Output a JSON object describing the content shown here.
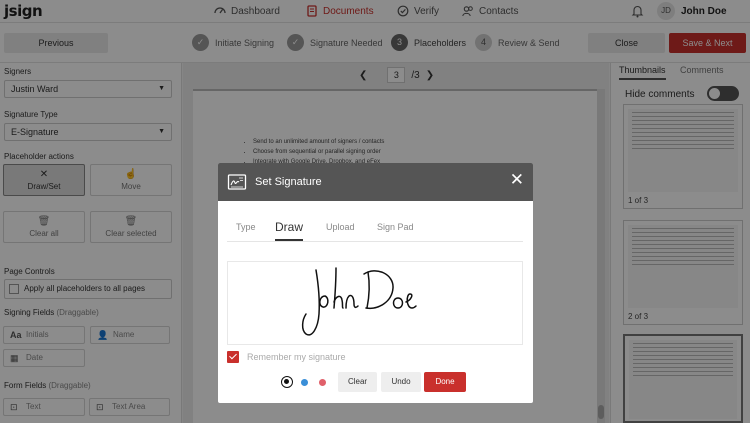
{
  "app": {
    "logo": "jsign"
  },
  "nav": {
    "items": [
      {
        "label": "Dashboard",
        "icon": "dashboard-icon"
      },
      {
        "label": "Documents",
        "icon": "document-icon",
        "active": true
      },
      {
        "label": "Verify",
        "icon": "verify-icon"
      },
      {
        "label": "Contacts",
        "icon": "contacts-icon"
      }
    ],
    "user": {
      "initials": "JD",
      "name": "John Doe"
    }
  },
  "steps": {
    "previous_label": "Previous",
    "items": [
      {
        "number": "✓",
        "label": "Initiate Signing",
        "state": "done"
      },
      {
        "number": "✓",
        "label": "Signature Needed",
        "state": "done"
      },
      {
        "number": "3",
        "label": "Placeholders",
        "state": "current"
      },
      {
        "number": "4",
        "label": "Review & Send",
        "state": "future"
      }
    ],
    "close_label": "Close",
    "save_label": "Save & Next"
  },
  "sidebar": {
    "signers_label": "Signers",
    "signer_value": "Justin Ward",
    "signature_type_label": "Signature Type",
    "signature_type_value": "E-Signature",
    "placeholder_actions_label": "Placeholder actions",
    "actions": {
      "draw": "Draw/Set",
      "move": "Move",
      "clear_all": "Clear all",
      "clear_selected": "Clear selected"
    },
    "page_controls_label": "Page Controls",
    "apply_all_label": "Apply all placeholders to all pages",
    "signing_fields_label": "Signing Fields",
    "signing_fields_hint": "(Draggable)",
    "signing_fields": {
      "initials": "Initials",
      "name": "Name",
      "date": "Date"
    },
    "form_fields_label": "Form Fields",
    "form_fields_hint": "(Draggable)",
    "form_fields": {
      "text": "Text",
      "text_area": "Text Area"
    }
  },
  "viewer": {
    "page_current": "3",
    "page_total": "/3",
    "bullets": [
      "Send to an unlimited amount of signers / contacts",
      "Choose from sequential or parallel signing order",
      "Integrate with Google Drive, Dropbox, and eFex"
    ]
  },
  "right_panel": {
    "tabs": [
      "Thumbnails",
      "Comments"
    ],
    "hide_comments_label": "Hide comments",
    "thumbnails": [
      "1 of 3",
      "2 of 3"
    ]
  },
  "modal": {
    "title": "Set Signature",
    "tabs": [
      "Type",
      "Draw",
      "Upload",
      "Sign Pad"
    ],
    "active_tab": "Draw",
    "signature_text": "John Doe",
    "remember_label": "Remember my signature",
    "remember_checked": true,
    "colors": [
      "#111111",
      "#3a8fd8",
      "#e0606a"
    ],
    "selected_color": "#111111",
    "buttons": {
      "clear": "Clear",
      "undo": "Undo",
      "done": "Done"
    }
  },
  "theme": {
    "accent": "#c9302c",
    "header_dark": "#555555"
  }
}
